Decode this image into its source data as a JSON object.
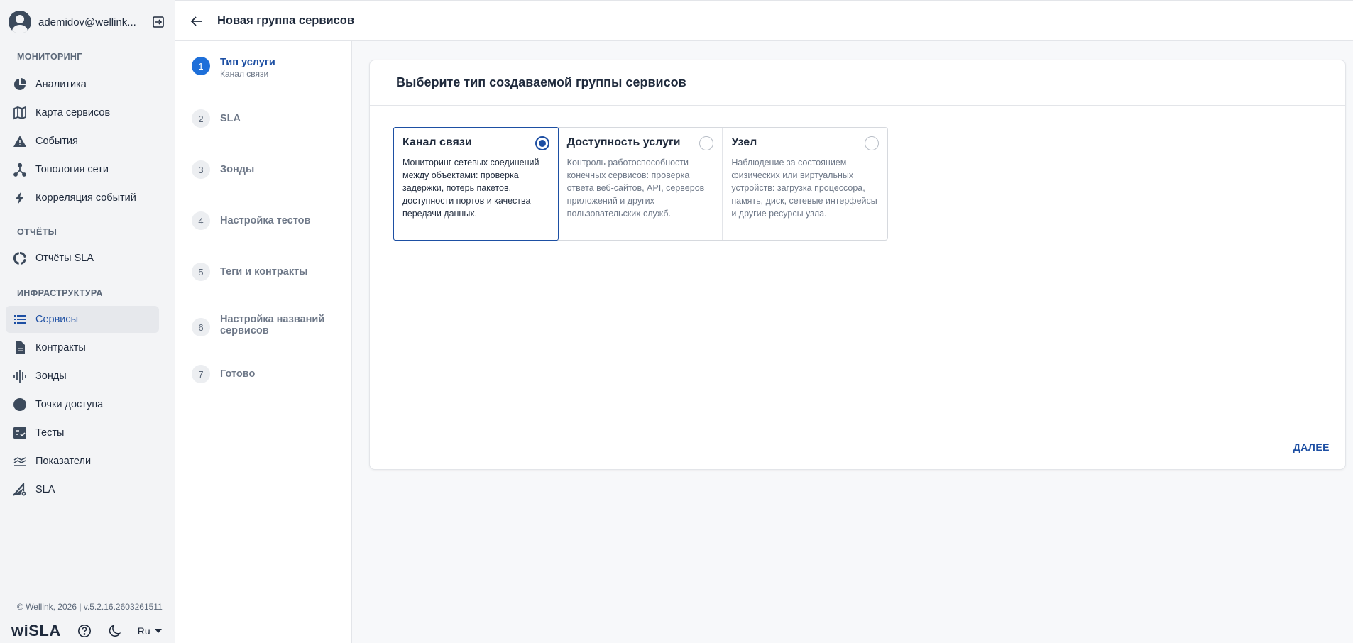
{
  "user": {
    "name": "ademidov@wellink..."
  },
  "sidebar": {
    "sections": {
      "monitoring": "МОНИТОРИНГ",
      "reports": "ОТЧЁТЫ",
      "infrastructure": "ИНФРАСТРУКТУРА"
    },
    "items": {
      "analytics": "Аналитика",
      "service_map": "Карта сервисов",
      "events": "События",
      "topology": "Топология сети",
      "correlation": "Корреляция событий",
      "sla_reports": "Отчёты SLA",
      "services": "Сервисы",
      "contracts": "Контракты",
      "probes": "Зонды",
      "access_points": "Точки доступа",
      "tests": "Тесты",
      "metrics": "Показатели",
      "sla": "SLA"
    },
    "active_item": "services",
    "version": "© Wellink, 2026 | v.5.2.16.2603261511",
    "brand": "wiSLA",
    "language": "Ru"
  },
  "header": {
    "title": "Новая группа сервисов"
  },
  "stepper": {
    "steps": [
      {
        "num": "1",
        "label": "Тип услуги",
        "sub": "Канал связи",
        "active": true
      },
      {
        "num": "2",
        "label": "SLA"
      },
      {
        "num": "3",
        "label": "Зонды"
      },
      {
        "num": "4",
        "label": "Настройка тестов"
      },
      {
        "num": "5",
        "label": "Теги и контракты"
      },
      {
        "num": "6",
        "label": "Настройка названий сервисов"
      },
      {
        "num": "7",
        "label": "Готово"
      }
    ]
  },
  "card": {
    "title": "Выберите тип создаваемой группы сервисов",
    "options": [
      {
        "title": "Канал связи",
        "desc": "Мониторинг сетевых соединений между объектами: проверка задержки, потерь пакетов, доступности портов и качества передачи данных.",
        "selected": true
      },
      {
        "title": "Доступность услуги",
        "desc": "Контроль работоспособности конечных сервисов: проверка ответа веб-сайтов, API, серверов приложений и других пользовательских служб.",
        "selected": false
      },
      {
        "title": "Узел",
        "desc": "Наблюдение за состоянием физических или виртуальных устройств: загрузка процессора, память, диск, сетевые интерфейсы и другие ресурсы узла.",
        "selected": false
      }
    ],
    "next_label": "ДАЛЕЕ"
  },
  "colors": {
    "accent": "#1d4fa3",
    "step_active": "#1e6fd9",
    "text": "#1f2a3c",
    "muted": "#6e7888"
  }
}
